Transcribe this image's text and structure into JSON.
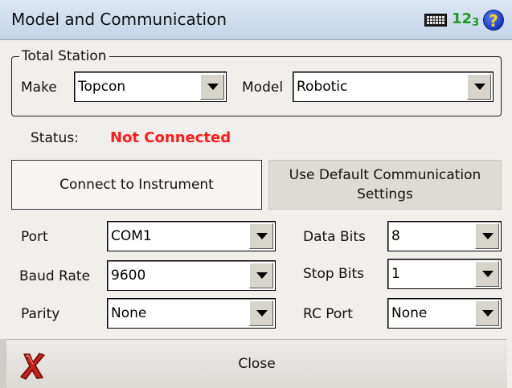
{
  "window": {
    "title": "Model and Communication",
    "icons": {
      "keyboard": "keyboard-icon",
      "input_mode": "input-mode-123-icon",
      "help": "help-icon"
    },
    "input_mode_main": "1",
    "input_mode_sub": "2",
    "input_mode_tail": "3",
    "help_glyph": "?"
  },
  "total_station": {
    "legend": "Total Station",
    "make_label": "Make",
    "make_value": "Topcon",
    "model_label": "Model",
    "model_value": "Robotic"
  },
  "status": {
    "label": "Status:",
    "value": "Not Connected",
    "value_color": "#ff1a1a"
  },
  "buttons": {
    "connect": "Connect to Instrument",
    "default_line1": "Use Default Communication",
    "default_line2": "Settings"
  },
  "comm": {
    "port_label": "Port",
    "port_value": "COM1",
    "baud_label": "Baud Rate",
    "baud_value": "9600",
    "parity_label": "Parity",
    "parity_value": "None",
    "data_bits_label": "Data Bits",
    "data_bits_value": "8",
    "stop_bits_label": "Stop Bits",
    "stop_bits_value": "1",
    "rc_port_label": "RC Port",
    "rc_port_value": "None"
  },
  "footer": {
    "close_label": "Close",
    "close_icon": "close-x-icon"
  }
}
